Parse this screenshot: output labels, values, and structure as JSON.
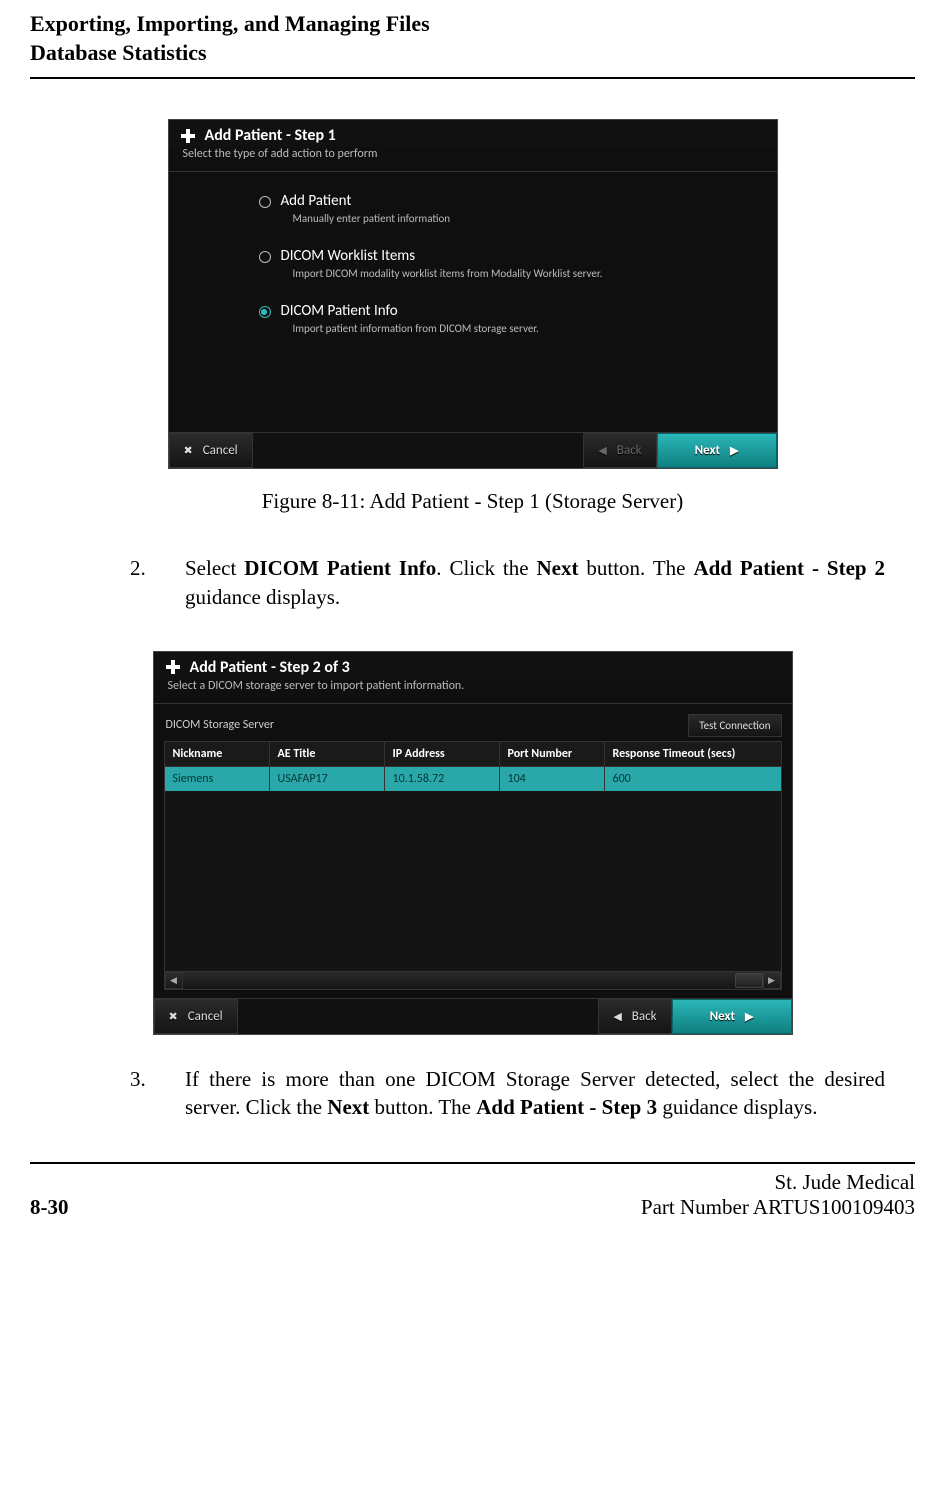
{
  "header": {
    "line1": "Exporting, Importing, and Managing Files",
    "line2": "Database Statistics"
  },
  "figure1": {
    "title": "Add Patient - Step 1",
    "subtitle": "Select the type of add action to perform",
    "options": [
      {
        "label": "Add Patient",
        "desc": "Manually enter patient information",
        "selected": false
      },
      {
        "label": "DICOM Worklist Items",
        "desc": "Import DICOM modality worklist items from Modality Worklist server.",
        "selected": false
      },
      {
        "label": "DICOM Patient Info",
        "desc": "Import patient information from DICOM storage server.",
        "selected": true
      }
    ],
    "buttons": {
      "cancel": "Cancel",
      "back": "Back",
      "next": "Next"
    },
    "caption": "Figure 8-11:  Add Patient - Step 1 (Storage Server)"
  },
  "step2": {
    "num": "2.",
    "text_before": "Select ",
    "bold1": "DICOM Patient Info",
    "text_mid1": ". Click the ",
    "bold2": "Next",
    "text_mid2": " button. The ",
    "bold3": "Add Patient - Step 2",
    "text_after": " guidance displays."
  },
  "figure2": {
    "title": "Add Patient - Step 2 of 3",
    "subtitle": "Select a DICOM storage server to import patient information.",
    "server_label": "DICOM Storage Server",
    "test_conn": "Test Connection",
    "columns": {
      "nick": "Nickname",
      "ae": "AE Title",
      "ip": "IP Address",
      "port": "Port Number",
      "rt": "Response Timeout (secs)"
    },
    "row": {
      "nick": "Siemens",
      "ae": "USAFAP17",
      "ip": "10.1.58.72",
      "port": "104",
      "rt": "600"
    },
    "buttons": {
      "cancel": "Cancel",
      "back": "Back",
      "next": "Next"
    }
  },
  "step3": {
    "num": "3.",
    "text_before": "If there is more than one DICOM Storage Server detected, select the desired server. Click the ",
    "bold1": "Next",
    "text_mid1": " button. The ",
    "bold2": "Add Patient - Step 3",
    "text_after": " guidance displays."
  },
  "footer": {
    "page": "8-30",
    "org": "St. Jude Medical",
    "part": "Part Number ARTUS100109403"
  }
}
